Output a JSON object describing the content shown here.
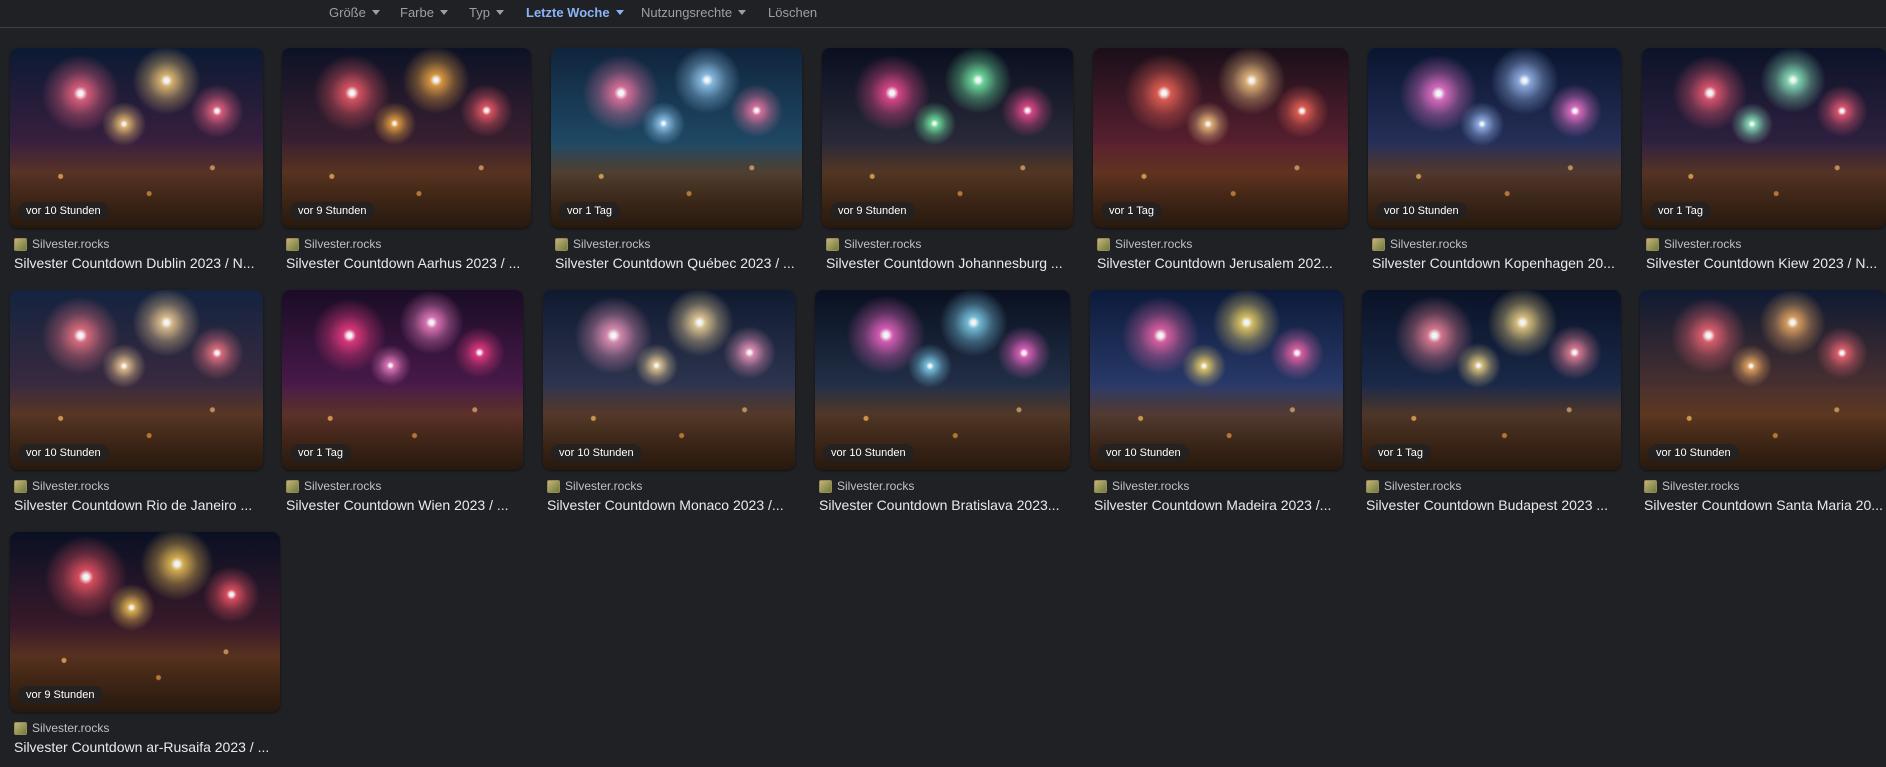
{
  "filters": [
    {
      "label": "Größe",
      "active": false
    },
    {
      "label": "Farbe",
      "active": false
    },
    {
      "label": "Typ",
      "active": false
    },
    {
      "label": "Letzte Woche",
      "active": true
    },
    {
      "label": "Nutzungsrechte",
      "active": false
    },
    {
      "label": "Löschen",
      "active": false
    }
  ],
  "results": [
    {
      "time": "vor 10 Stunden",
      "source": "Silvester.rocks",
      "title": "Silvester Countdown Dublin 2023 / N..."
    },
    {
      "time": "vor 9 Stunden",
      "source": "Silvester.rocks",
      "title": "Silvester Countdown Aarhus 2023 / ..."
    },
    {
      "time": "vor 1 Tag",
      "source": "Silvester.rocks",
      "title": "Silvester Countdown Québec 2023 / ..."
    },
    {
      "time": "vor 9 Stunden",
      "source": "Silvester.rocks",
      "title": "Silvester Countdown Johannesburg ..."
    },
    {
      "time": "vor 1 Tag",
      "source": "Silvester.rocks",
      "title": "Silvester Countdown Jerusalem 202..."
    },
    {
      "time": "vor 10 Stunden",
      "source": "Silvester.rocks",
      "title": "Silvester Countdown Kopenhagen 20..."
    },
    {
      "time": "vor 1 Tag",
      "source": "Silvester.rocks",
      "title": "Silvester Countdown Kiew 2023 / N..."
    },
    {
      "time": "vor 10 Stunden",
      "source": "Silvester.rocks",
      "title": "Silvester Countdown Rio de Janeiro ..."
    },
    {
      "time": "vor 1 Tag",
      "source": "Silvester.rocks",
      "title": "Silvester Countdown Wien 2023 / ..."
    },
    {
      "time": "vor 10 Stunden",
      "source": "Silvester.rocks",
      "title": "Silvester Countdown Monaco 2023 /..."
    },
    {
      "time": "vor 10 Stunden",
      "source": "Silvester.rocks",
      "title": "Silvester Countdown Bratislava 2023..."
    },
    {
      "time": "vor 10 Stunden",
      "source": "Silvester.rocks",
      "title": "Silvester Countdown Madeira 2023 /..."
    },
    {
      "time": "vor 1 Tag",
      "source": "Silvester.rocks",
      "title": "Silvester Countdown Budapest 2023 ..."
    },
    {
      "time": "vor 10 Stunden",
      "source": "Silvester.rocks",
      "title": "Silvester Countdown Santa Maria 20..."
    },
    {
      "time": "vor 9 Stunden",
      "source": "Silvester.rocks",
      "title": "Silvester Countdown ar-Rusaifa 2023 / ..."
    }
  ],
  "colors": {
    "background": "#202124",
    "active_filter": "#8ab4f8",
    "filter": "#9aa0a6"
  },
  "icons": {
    "filter_caret": "chevron-down-icon",
    "source_favicon": "favicon-icon"
  }
}
